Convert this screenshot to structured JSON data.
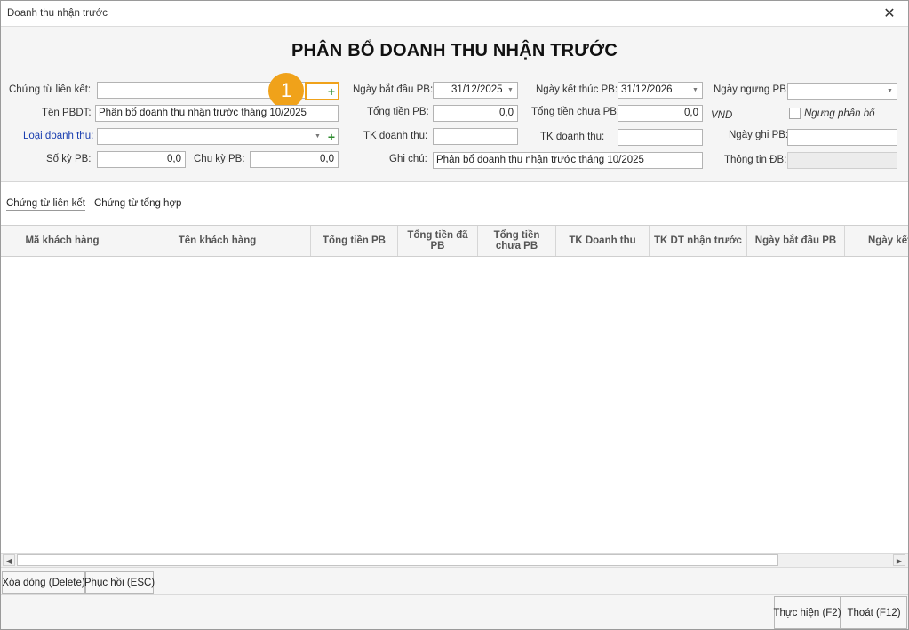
{
  "window": {
    "title": "Doanh thu nhận trước",
    "close_glyph": "✕"
  },
  "heading": "PHÂN BỔ DOANH THU NHẬN TRƯỚC",
  "form": {
    "chung_tu_lien_ket": {
      "label": "Chứng từ liên kết:",
      "value": ""
    },
    "ten_pbdt": {
      "label": "Tên PBDT:",
      "value": "Phân bổ doanh thu nhận trước tháng 10/2025"
    },
    "loai_doanh_thu": {
      "label": "Loại doanh thu:",
      "value": ""
    },
    "so_ky_pb": {
      "label": "Số kỳ PB:",
      "value": "0,0"
    },
    "chu_ky_pb": {
      "label": "Chu kỳ PB:",
      "value": "0,0"
    },
    "ngay_bat_dau_pb": {
      "label": "Ngày bắt đầu PB:",
      "value": "31/12/2025"
    },
    "tong_tien_pb": {
      "label": "Tổng tiền PB:",
      "value": "0,0"
    },
    "tk_doanh_thu_1": {
      "label": "TK doanh thu:",
      "value": ""
    },
    "ghi_chu": {
      "label": "Ghi chú:",
      "value": "Phân bổ doanh thu nhận trước tháng 10/2025"
    },
    "ngay_ket_thuc_pb": {
      "label": "Ngày kết thúc PB:",
      "value": "31/12/2026"
    },
    "tong_tien_chua_pb": {
      "label": "Tổng tiền chưa PB:",
      "value": "0,0"
    },
    "tk_doanh_thu_2": {
      "label": "TK doanh thu:",
      "value": ""
    },
    "ngay_ngung_pb": {
      "label": "Ngày ngưng PB:",
      "value": ""
    },
    "currency": "VND",
    "ngung_phan_bo": {
      "label": "Ngưng phân bổ",
      "checked": false
    },
    "ngay_ghi_pb": {
      "label": "Ngày ghi PB:",
      "value": ""
    },
    "thong_tin_db": {
      "label": "Thông tin ĐB:",
      "value": ""
    }
  },
  "callout": {
    "number": "1",
    "color": "#f0a21a"
  },
  "tabs": [
    {
      "label": "Chứng từ liên kết",
      "active": true
    },
    {
      "label": "Chứng từ tổng hợp",
      "active": false
    }
  ],
  "grid": {
    "columns": [
      "Mã khách hàng",
      "Tên khách hàng",
      "Tổng tiền PB",
      "Tổng tiền đã\nPB",
      "Tổng tiền\nchưa PB",
      "TK Doanh thu",
      "TK DT nhận trước",
      "Ngày bắt đầu PB",
      "Ngày kết"
    ],
    "rows": []
  },
  "row_actions": {
    "delete_label": "Xóa dòng (Delete)",
    "restore_label": "Phục hồi (ESC)"
  },
  "footer": {
    "execute_label": "Thực hiện (F2)",
    "exit_label": "Thoát  (F12)"
  },
  "icons": {
    "plus": "+",
    "dropdown": "▼",
    "scroll_left": "◀",
    "scroll_right": "▶"
  }
}
